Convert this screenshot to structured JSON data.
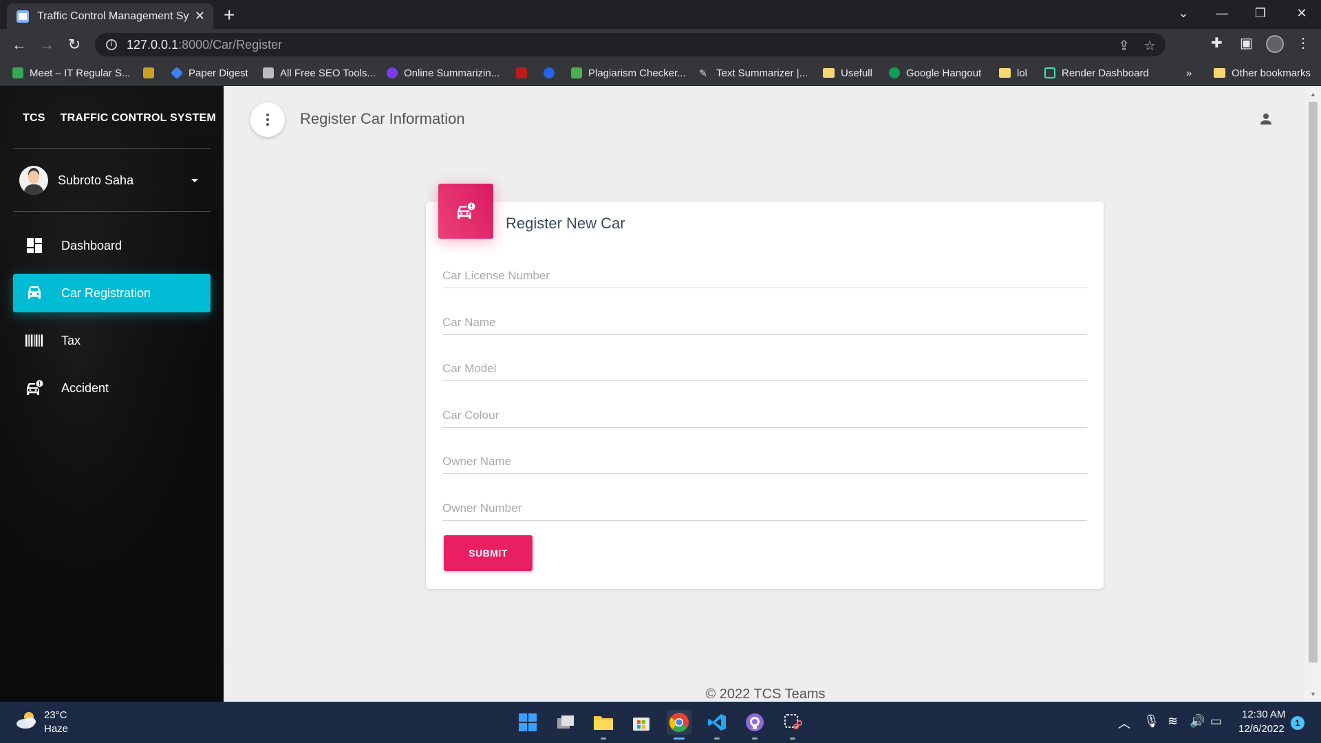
{
  "browser": {
    "tab_title": "Traffic Control Management Syst",
    "url_host": "127.0.0.1",
    "url_path": ":8000/Car/Register",
    "bookmarks": [
      {
        "label": "Meet – IT Regular S...",
        "color": "#34a853"
      },
      {
        "label": "",
        "color": "#c9a227"
      },
      {
        "label": "Paper Digest",
        "color": "#3b82f6"
      },
      {
        "label": "All Free SEO Tools...",
        "color": "#bbbbbb"
      },
      {
        "label": "Online Summarizin...",
        "color": "#7c3aed"
      },
      {
        "label": "",
        "color": "#b91c1c"
      },
      {
        "label": "",
        "color": "#2563eb"
      },
      {
        "label": "Plagiarism Checker...",
        "color": "#4caf50"
      },
      {
        "label": "Text Summarizer |...",
        "color": "#dddddd"
      },
      {
        "label": "Usefull",
        "color": "#f8d775"
      },
      {
        "label": "Google Hangout",
        "color": "#0f9d58"
      },
      {
        "label": "lol",
        "color": "#f8d775"
      },
      {
        "label": "Render Dashboard",
        "color": "#46e3b7"
      }
    ],
    "overflow_label": "»",
    "other_bookmarks": "Other bookmarks"
  },
  "sidebar": {
    "brand_short": "TCS",
    "brand_full": "TRAFFIC CONTROL SYSTEM",
    "user_name": "Subroto Saha",
    "items": [
      {
        "label": "Dashboard",
        "icon": "dashboard-icon",
        "active": false
      },
      {
        "label": "Car Registration",
        "icon": "car-icon",
        "active": true
      },
      {
        "label": "Tax",
        "icon": "barcode-icon",
        "active": false
      },
      {
        "label": "Accident",
        "icon": "car-alert-icon",
        "active": false
      }
    ]
  },
  "header": {
    "title": "Register Car Information"
  },
  "form": {
    "title": "Register New Car",
    "fields": [
      {
        "placeholder": "Car License Number",
        "value": ""
      },
      {
        "placeholder": "Car Name",
        "value": ""
      },
      {
        "placeholder": "Car Model",
        "value": ""
      },
      {
        "placeholder": "Car Colour",
        "value": ""
      },
      {
        "placeholder": "Owner Name",
        "value": ""
      },
      {
        "placeholder": "Owner Number",
        "value": ""
      }
    ],
    "submit_label": "SUBMIT"
  },
  "footer": {
    "text": "© 2022 TCS Teams"
  },
  "colors": {
    "accent_active": "#00bcd4",
    "accent_primary": "#e91e63"
  },
  "taskbar": {
    "temperature": "23°C",
    "weather": "Haze",
    "time": "12:30 AM",
    "date": "12/6/2022",
    "notification_count": "1"
  }
}
